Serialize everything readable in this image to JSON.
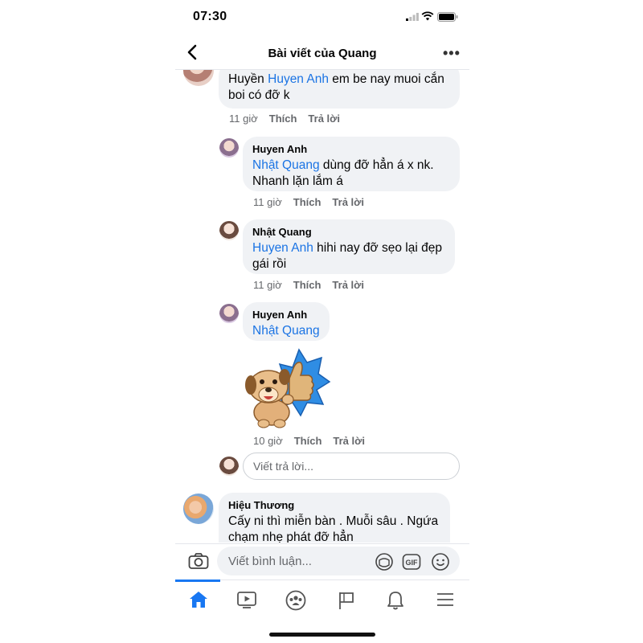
{
  "status_bar": {
    "time": "07:30"
  },
  "header": {
    "title": "Bài viết của Quang"
  },
  "comments": [
    {
      "author": "",
      "mention": "Huyen Anh",
      "text_prefix": "Huyền ",
      "text": " em be nay muoi cắn boi có đỡ k",
      "time": "11 giờ",
      "like": "Thích",
      "reply": "Trả lời"
    },
    {
      "author": "Huyen Anh",
      "mention": "Nhật Quang",
      "text": " dùng đỡ hẳn á x nk. Nhanh lặn lắm á",
      "time": "11 giờ",
      "like": "Thích",
      "reply": "Trả lời"
    },
    {
      "author": "Nhật Quang",
      "mention": "Huyen Anh",
      "text": " hihi nay đỡ sẹo lại đẹp gái rồi",
      "time": "11 giờ",
      "like": "Thích",
      "reply": "Trả lời"
    },
    {
      "author": "Huyen Anh",
      "mention": "Nhật Quang",
      "sticker": "dog-thumbs-up-sticker",
      "time": "10 giờ",
      "like": "Thích",
      "reply": "Trả lời"
    },
    {
      "author": "Hiệu Thương",
      "text": "Cấy ni thì miễn bàn . Muỗi sâu . Ngứa chạm nhẹ phát đỡ hẳn"
    }
  ],
  "reply_input": {
    "placeholder": "Viết trả lời..."
  },
  "composer": {
    "placeholder": "Viết bình luận..."
  },
  "icons": {
    "camera": "camera-icon",
    "sticker": "sticker-icon",
    "gif": "GIF",
    "emoji": "emoji-icon",
    "tabs": [
      "home-icon",
      "video-icon",
      "groups-icon",
      "pages-flag-icon",
      "notifications-bell-icon",
      "menu-icon"
    ]
  },
  "colors": {
    "accent": "#1877f2",
    "mention": "#1b74e4",
    "bubble": "#f0f2f5",
    "meta": "#65676b"
  }
}
